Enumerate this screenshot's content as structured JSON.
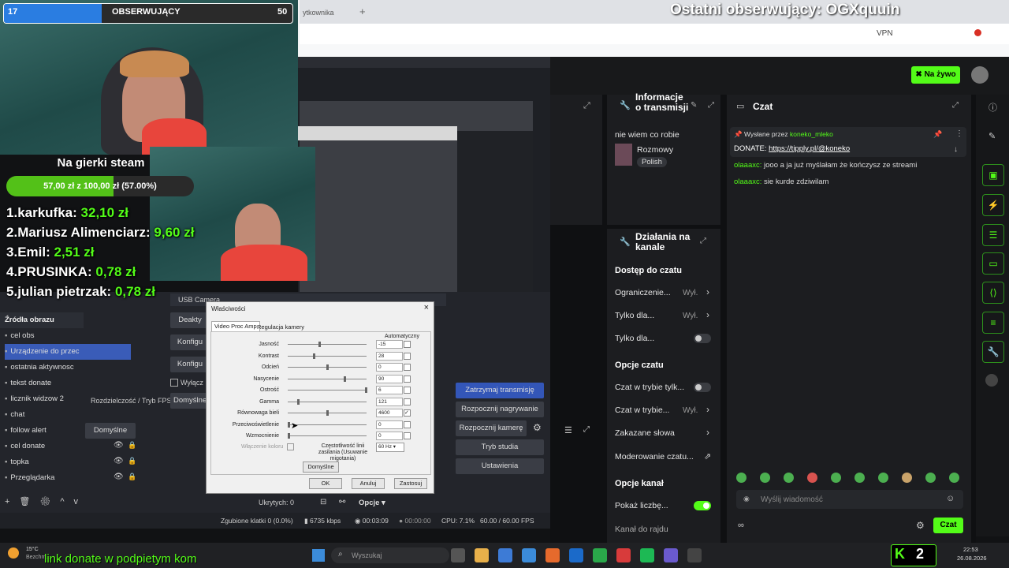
{
  "overlay": {
    "follower_label": "OBSERWUJĄCY",
    "follower_left": "17",
    "follower_right": "50",
    "follower_fraction": 0.34,
    "last_follower": "Ostatni obserwujący: OGXquuin",
    "goal_title": "Na gierki steam",
    "goal_text": "57,00 zł z 100,00 zł (57.00%)",
    "goal_fraction": 0.57,
    "donors": [
      {
        "rank": "1.",
        "name": "karkufka:",
        "amount": "32,10 zł"
      },
      {
        "rank": "2.",
        "name": "Mariusz Alimenciarz:",
        "amount": "9,60 zł"
      },
      {
        "rank": "3.",
        "name": "Emil:",
        "amount": "2,51 zł"
      },
      {
        "rank": "4.",
        "name": "PRUSINKA:",
        "amount": "0,78 zł"
      },
      {
        "rank": "5.",
        "name": "julian pietrzak:",
        "amount": "0,78 zł"
      }
    ],
    "bottom_text": "link donate w podpietym kom"
  },
  "browser": {
    "tab_label": "ytkownika",
    "vpn": "VPN"
  },
  "kick": {
    "live_label": "Na żywo",
    "stream_info": {
      "title": "Informacje o transmisji",
      "stream_title": "nie wiem co robie",
      "category": "Rozmowy",
      "language": "Polish"
    },
    "channel_actions": {
      "title": "Działania na kanale",
      "chat_access_heading": "Dostęp do czatu",
      "rows": [
        {
          "label": "Ograniczenie...",
          "value": "Wył."
        },
        {
          "label": "Tylko dla...",
          "value": "Wył."
        },
        {
          "label": "Tylko dla...",
          "value": ""
        }
      ],
      "chat_options_heading": "Opcje czatu",
      "chat_rows": [
        {
          "label": "Czat w trybie tylk...",
          "value": ""
        },
        {
          "label": "Czat w trybie...",
          "value": "Wył."
        },
        {
          "label": "Zakazane słowa",
          "value": ""
        },
        {
          "label": "Moderowanie czatu...",
          "value": ""
        }
      ],
      "channel_options_heading": "Opcje kanał",
      "channel_rows": [
        {
          "label": "Pokaż liczbę...",
          "value": ""
        },
        {
          "label": "Kanał do rajdu",
          "value": ""
        }
      ]
    },
    "chat": {
      "title": "Czat",
      "pinned_by": "Wysłane przez",
      "pinned_user": "koneko_mleko",
      "pinned_prefix": "DONATE:",
      "pinned_link": "https://tipply.pl/@koneko",
      "messages": [
        {
          "user": "olaaaxc:",
          "text": "jooo a ja już myślałam że kończysz ze streami"
        },
        {
          "user": "olaaaxc:",
          "text": "sie kurde zdziwilam"
        }
      ],
      "input_placeholder": "Wyślij wiadomość",
      "send_label": "Czat"
    }
  },
  "obs": {
    "sources_title": "Źródła obrazu",
    "sources": [
      "cel obs",
      "Urządzenie do przec",
      "ostatnia aktywnosc",
      "tekst donate",
      "licznik widzow 2",
      "chat",
      "follow alert",
      "cel donate",
      "topka",
      "Przeglądarka"
    ],
    "usb_label": "USB Camera",
    "deactivate_label": "Deakty",
    "configure_label": "Konfigu",
    "configure_label2": "Konfigu",
    "turn_off_label": "Wyłącz",
    "resolution_label": "Rozdzielczość / Tryb FPS",
    "resolution_value": "Domyślne",
    "default_button": "Domyślne",
    "controls": [
      "Zatrzymaj transmisję",
      "Rozpocznij nagrywanie",
      "Rozpocznij kamerę wirtualną",
      "Tryb studia",
      "Ustawienia"
    ],
    "hidden_label": "Ukrytych: 0",
    "options_label": "Opcje",
    "status": {
      "dropped": "Zgubione klatki 0 (0.0%)",
      "bitrate": "6735 kbps",
      "stream_time": "00:03:09",
      "rec_time": "00:00:00",
      "cpu": "CPU: 7.1%",
      "fps": "60.00 / 60.00 FPS"
    }
  },
  "dialog": {
    "title": "Właściwości",
    "tabs": [
      "Video Proc Amp",
      "Regulacja kamery"
    ],
    "auto_label": "Automatyczny",
    "sliders": [
      {
        "label": "Jasność",
        "value": "-15",
        "pos": 0.4,
        "checked": false
      },
      {
        "label": "Kontrast",
        "value": "28",
        "pos": 0.33,
        "checked": false
      },
      {
        "label": "Odcień",
        "value": "0",
        "pos": 0.5,
        "checked": false
      },
      {
        "label": "Nasycenie",
        "value": "90",
        "pos": 0.72,
        "checked": false
      },
      {
        "label": "Ostrość",
        "value": "6",
        "pos": 1.0,
        "checked": false
      },
      {
        "label": "Gamma",
        "value": "121",
        "pos": 0.12,
        "checked": false
      },
      {
        "label": "Równowaga bieli",
        "value": "4600",
        "pos": 0.5,
        "checked": true
      },
      {
        "label": "Przeciwoświetlenie",
        "value": "0",
        "pos": 0.0,
        "checked": false
      },
      {
        "label": "Wzmocnienie",
        "value": "0",
        "pos": 0.0,
        "checked": false
      }
    ],
    "color_enable": "Włączenie koloru",
    "flicker_label": "Częstotliwość linii zasilania (Usuwanie migotania)",
    "flicker_value": "60 Hz",
    "default_btn": "Domyślne",
    "ok": "OK",
    "cancel": "Anuluj",
    "apply": "Zastosuj"
  },
  "taskbar": {
    "weather": "15°C",
    "weather_sub": "Bezchm...",
    "search_placeholder": "Wyszukaj",
    "time": "22:53",
    "date": "26.08.2026"
  },
  "colors": {
    "kick_green": "#53fc18",
    "follow_blue": "#2a7de1",
    "shirt": "#e8453c"
  }
}
